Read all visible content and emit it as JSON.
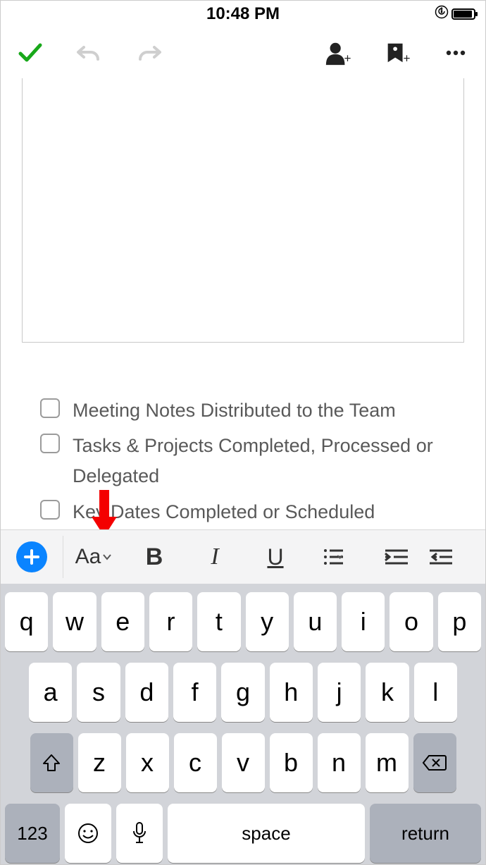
{
  "status": {
    "time": "10:48 PM"
  },
  "checklist": [
    {
      "text": "Meeting Notes Distributed to the Team"
    },
    {
      "text": "Tasks & Projects Completed, Processed or Delegated"
    },
    {
      "text": "Key Dates Completed or Scheduled"
    }
  ],
  "format_bar": {
    "font_label": "Aa",
    "bold": "B",
    "italic": "I",
    "underline": "U"
  },
  "keyboard": {
    "row1": [
      "q",
      "w",
      "e",
      "r",
      "t",
      "y",
      "u",
      "i",
      "o",
      "p"
    ],
    "row2": [
      "a",
      "s",
      "d",
      "f",
      "g",
      "h",
      "j",
      "k",
      "l"
    ],
    "row3": [
      "z",
      "x",
      "c",
      "v",
      "b",
      "n",
      "m"
    ],
    "num": "123",
    "space": "space",
    "return": "return"
  }
}
